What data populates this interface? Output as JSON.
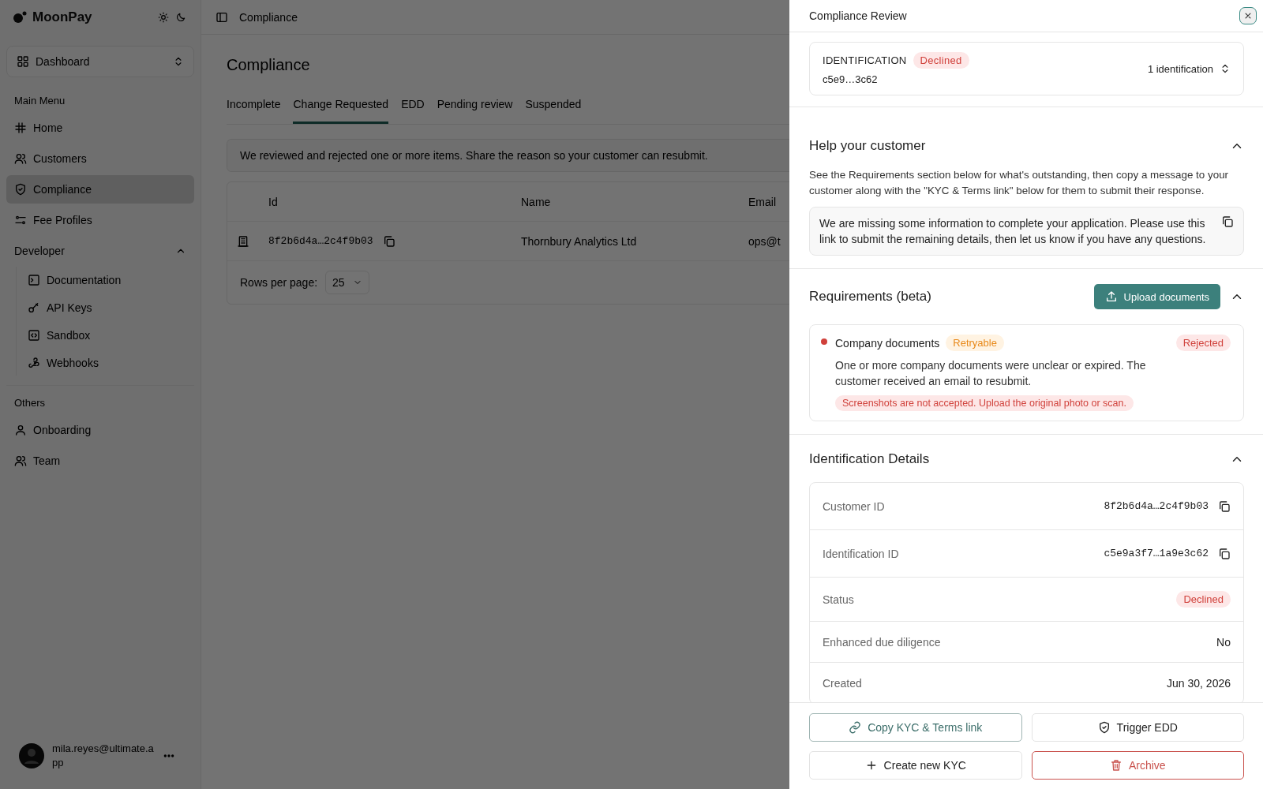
{
  "sidebar": {
    "logo": "MoonPay",
    "workspace": "Dashboard",
    "sections": [
      {
        "title": "Main Menu",
        "items": [
          {
            "label": "Home",
            "selected": false
          },
          {
            "label": "Customers",
            "selected": false
          },
          {
            "label": "Compliance",
            "selected": true
          },
          {
            "label": "Fee Profiles",
            "selected": false
          }
        ]
      },
      {
        "title": "Developer",
        "expanded": true,
        "items": [
          {
            "label": "Documentation",
            "selected": false
          },
          {
            "label": "API Keys",
            "selected": false
          },
          {
            "label": "Sandbox",
            "selected": false
          },
          {
            "label": "Webhooks",
            "selected": false
          }
        ]
      },
      {
        "title": "Others",
        "items": [
          {
            "label": "Onboarding",
            "selected": false
          },
          {
            "label": "Team",
            "selected": false
          }
        ]
      }
    ],
    "user": {
      "email": "mila.reyes@ultimate.app"
    }
  },
  "header": {
    "breadcrumb": "Compliance"
  },
  "page": {
    "title": "Compliance",
    "tabs": [
      {
        "label": "Incomplete",
        "selected": false
      },
      {
        "label": "Change Requested",
        "selected": true
      },
      {
        "label": "EDD",
        "selected": false
      },
      {
        "label": "Pending review",
        "selected": false
      },
      {
        "label": "Suspended",
        "selected": false
      }
    ],
    "notice": "We reviewed and rejected one or more items. Share the reason so your customer can resubmit.",
    "table": {
      "columns": [
        "Id",
        "Name",
        "Email"
      ],
      "rows": [
        {
          "id": "8f2b6d4a…2c4f9b03",
          "name": "Thornbury Analytics Ltd",
          "email": "ops@t"
        }
      ]
    },
    "rows_per_page": {
      "label": "Rows per page:",
      "value": "25"
    }
  },
  "panel": {
    "title": "Compliance Review",
    "identification": {
      "label": "IDENTIFICATION",
      "status": {
        "text": "Declined",
        "kind": "danger"
      },
      "id": "c5e9…3c62",
      "count": "1 identification"
    },
    "help": {
      "title": "Help your customer",
      "expanded": true,
      "description": "See the Requirements section below for what's outstanding, then copy a message to your customer along with the \"KYC & Terms link\" below for them to submit their response.",
      "message": "We are missing some information to complete your application. Please use this link to submit the remaining details, then let us know if you have any questions."
    },
    "requirements": {
      "title": "Requirements (beta)",
      "upload": "Upload documents",
      "expanded": true,
      "items": [
        {
          "title": "Company documents",
          "tag": {
            "text": "Retryable",
            "kind": "warning"
          },
          "status": {
            "text": "Rejected",
            "kind": "danger"
          },
          "description": "One or more company documents were unclear or expired. The customer received an email to resubmit.",
          "note": "Screenshots are not accepted. Upload the original photo or scan."
        }
      ]
    },
    "details": {
      "title": "Identification Details",
      "expanded": true,
      "rows": [
        {
          "label": "Customer ID",
          "value": "8f2b6d4a…2c4f9b03",
          "kind": "copy"
        },
        {
          "label": "Identification ID",
          "value": "c5e9a3f7…1a9e3c62",
          "kind": "copy"
        },
        {
          "label": "Status",
          "value": "Declined",
          "kind": "danger"
        },
        {
          "label": "Enhanced due diligence",
          "value": "No",
          "kind": "text"
        },
        {
          "label": "Created",
          "value": "Jun 30, 2026",
          "kind": "text"
        }
      ]
    },
    "actions": [
      {
        "label": "Copy KYC & Terms link",
        "kind": "link"
      },
      {
        "label": "Trigger EDD",
        "kind": "shield"
      },
      {
        "label": "Create new KYC",
        "kind": "plus"
      },
      {
        "label": "Archive",
        "kind": "danger"
      }
    ]
  }
}
